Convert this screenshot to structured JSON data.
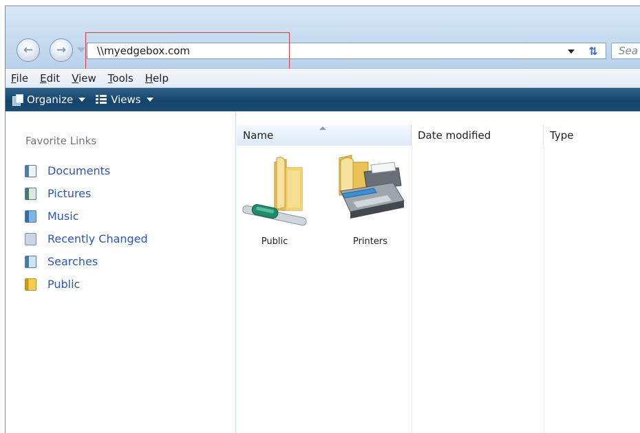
{
  "window": {
    "address": "\\\\myedgebox.com",
    "search_placeholder": "Sea"
  },
  "menu": {
    "items": [
      {
        "label": "File",
        "accel": "F",
        "rest": "ile"
      },
      {
        "label": "Edit",
        "accel": "E",
        "rest": "dit"
      },
      {
        "label": "View",
        "accel": "V",
        "rest": "iew"
      },
      {
        "label": "Tools",
        "accel": "T",
        "rest": "ools"
      },
      {
        "label": "Help",
        "accel": "H",
        "rest": "elp"
      }
    ]
  },
  "commands": {
    "organize": "Organize",
    "views": "Views"
  },
  "nav_pane": {
    "title": "Favorite Links",
    "items": [
      {
        "label": "Documents",
        "icon": "documents-icon"
      },
      {
        "label": "Pictures",
        "icon": "pictures-icon"
      },
      {
        "label": "Music",
        "icon": "music-icon"
      },
      {
        "label": "Recently Changed",
        "icon": "recently-changed-icon"
      },
      {
        "label": "Searches",
        "icon": "searches-icon"
      },
      {
        "label": "Public",
        "icon": "public-folder-icon"
      }
    ]
  },
  "file_list": {
    "columns": {
      "name": "Name",
      "date_modified": "Date modified",
      "type": "Type"
    },
    "items": [
      {
        "label": "Public",
        "icon": "network-share-folder-icon"
      },
      {
        "label": "Printers",
        "icon": "printers-folder-icon"
      }
    ]
  },
  "colors": {
    "command_bar": "#1f4f78",
    "link_text": "#2a57b3",
    "highlight_box": "#d93a3a"
  }
}
